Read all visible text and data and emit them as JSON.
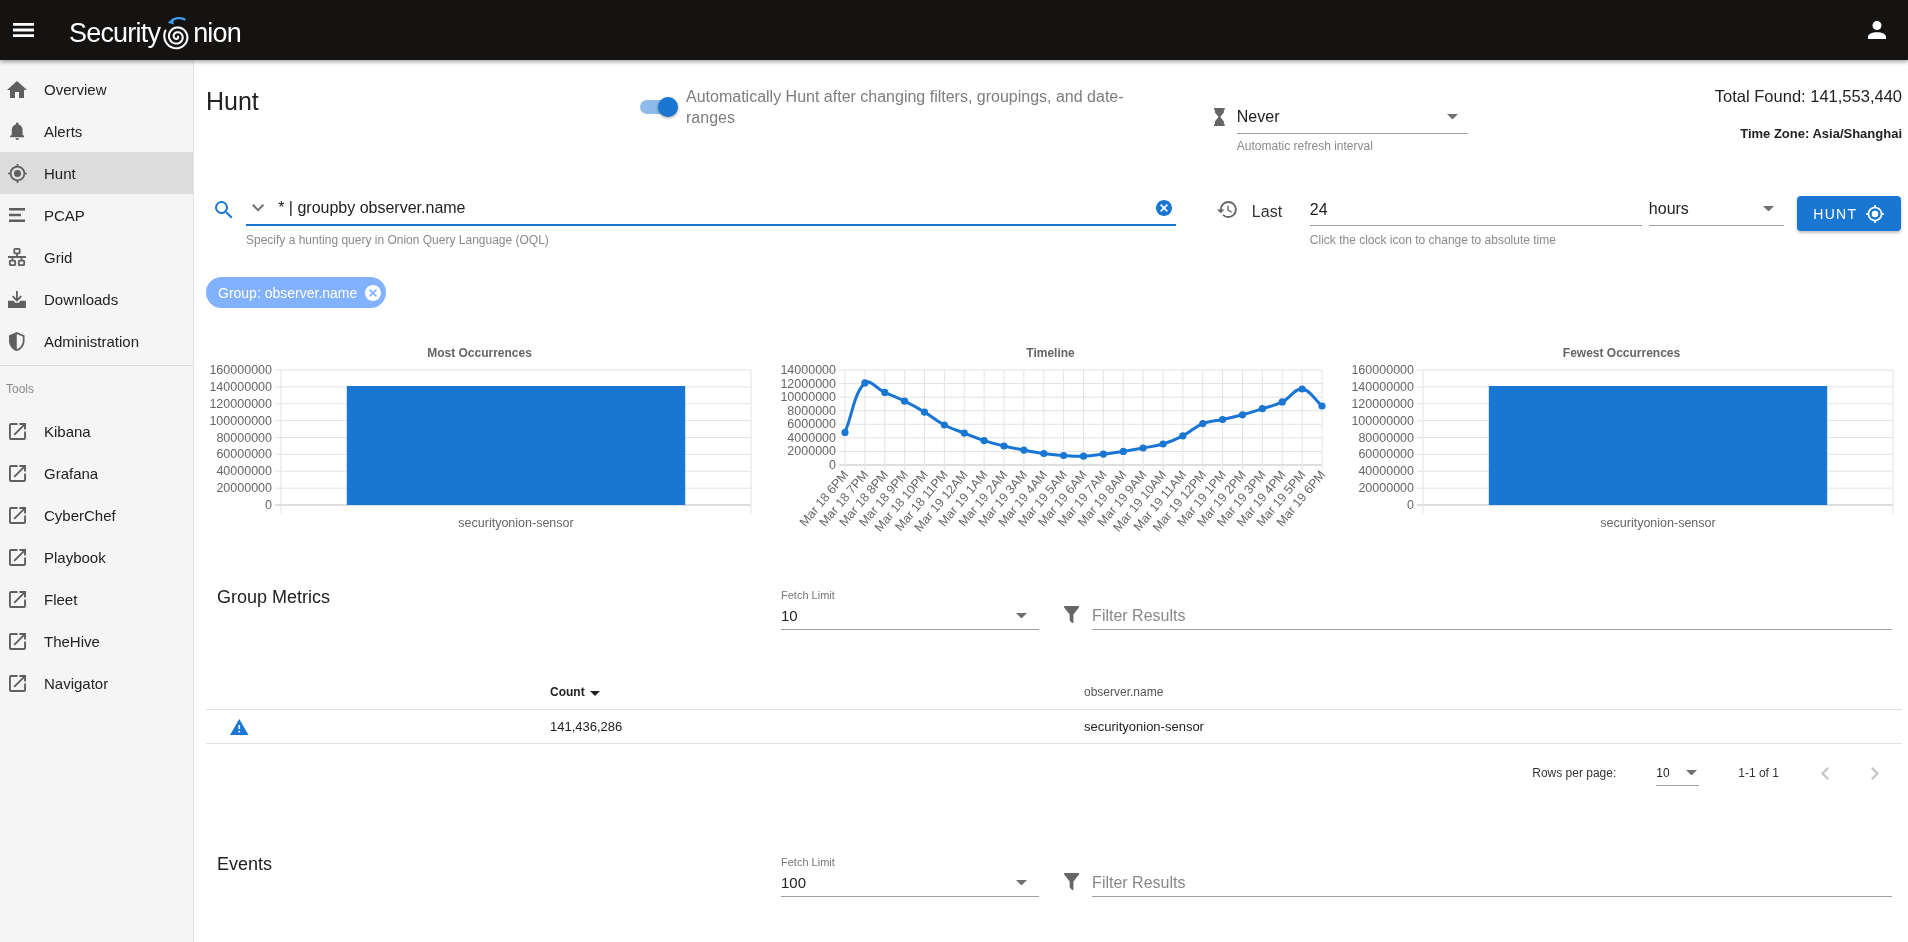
{
  "app_bar": {
    "logo_text_left": "Security",
    "logo_text_right": "nion"
  },
  "sidebar": {
    "items": [
      {
        "label": "Overview",
        "selected": false
      },
      {
        "label": "Alerts",
        "selected": false
      },
      {
        "label": "Hunt",
        "selected": true
      },
      {
        "label": "PCAP",
        "selected": false
      },
      {
        "label": "Grid",
        "selected": false
      },
      {
        "label": "Downloads",
        "selected": false
      },
      {
        "label": "Administration",
        "selected": false
      }
    ],
    "tools_title": "Tools",
    "tools": [
      {
        "label": "Kibana"
      },
      {
        "label": "Grafana"
      },
      {
        "label": "CyberChef"
      },
      {
        "label": "Playbook"
      },
      {
        "label": "Fleet"
      },
      {
        "label": "TheHive"
      },
      {
        "label": "Navigator"
      }
    ]
  },
  "header": {
    "title": "Hunt",
    "auto_hunt": {
      "on": true,
      "label": "Automatically Hunt after changing filters, groupings, and date-ranges"
    },
    "refresh": {
      "value": "Never",
      "hint": "Automatic refresh interval"
    },
    "total_found": "Total Found: 141,553,440",
    "time_zone": "Time Zone: Asia/Shanghai"
  },
  "query": {
    "value": "* | groupby observer.name",
    "hint": "Specify a hunting query in Onion Query Language (OQL)"
  },
  "time_range": {
    "label": "Last",
    "value": "24",
    "unit": "hours",
    "hint": "Click the clock icon to change to absolute time"
  },
  "hunt_button": {
    "label": "HUNT"
  },
  "chips": [
    {
      "label": "Group: observer.name"
    }
  ],
  "charts": [
    {
      "chart_data": {
        "type": "bar",
        "title": "Most Occurrences",
        "categories": [
          "securityonion-sensor"
        ],
        "values": [
          141000000
        ],
        "ylim": [
          0,
          160000000
        ],
        "yticks": [
          0,
          20000000,
          40000000,
          60000000,
          80000000,
          100000000,
          120000000,
          140000000,
          160000000
        ],
        "grid": true
      }
    },
    {
      "chart_data": {
        "type": "line",
        "title": "Timeline",
        "categories": [
          "Mar 18 6PM",
          "Mar 18 7PM",
          "Mar 18 8PM",
          "Mar 18 9PM",
          "Mar 18 10PM",
          "Mar 18 11PM",
          "Mar 19 12AM",
          "Mar 19 1AM",
          "Mar 19 2AM",
          "Mar 19 3AM",
          "Mar 19 4AM",
          "Mar 19 5AM",
          "Mar 19 6AM",
          "Mar 19 7AM",
          "Mar 19 8AM",
          "Mar 19 9AM",
          "Mar 19 10AM",
          "Mar 19 11AM",
          "Mar 19 12PM",
          "Mar 19 1PM",
          "Mar 19 2PM",
          "Mar 19 3PM",
          "Mar 19 4PM",
          "Mar 19 5PM",
          "Mar 19 6PM"
        ],
        "values": [
          4800000,
          12100000,
          10700000,
          9400000,
          7800000,
          5900000,
          4700000,
          3600000,
          2800000,
          2200000,
          1700000,
          1400000,
          1300000,
          1600000,
          2000000,
          2500000,
          3100000,
          4300000,
          6100000,
          6700000,
          7400000,
          8300000,
          9300000,
          11200000,
          8700000
        ],
        "ylim": [
          0,
          14000000
        ],
        "yticks": [
          0,
          2000000,
          4000000,
          6000000,
          8000000,
          10000000,
          12000000,
          14000000
        ],
        "grid": true,
        "marker": true
      }
    },
    {
      "chart_data": {
        "type": "bar",
        "title": "Fewest Occurrences",
        "categories": [
          "securityonion-sensor"
        ],
        "values": [
          141000000
        ],
        "ylim": [
          0,
          160000000
        ],
        "yticks": [
          0,
          20000000,
          40000000,
          60000000,
          80000000,
          100000000,
          120000000,
          140000000,
          160000000
        ],
        "grid": true
      }
    }
  ],
  "group_metrics": {
    "title": "Group Metrics",
    "fetch_limit": {
      "label": "Fetch Limit",
      "value": "10"
    },
    "filter": {
      "placeholder": "Filter Results"
    },
    "table": {
      "columns": [
        {
          "label": "Count",
          "sorted": true
        },
        {
          "label": "observer.name",
          "sorted": false
        }
      ],
      "rows": [
        {
          "cells": [
            "141,436,286",
            "securityonion-sensor"
          ]
        }
      ]
    },
    "pagination": {
      "rows_per_page_label": "Rows per page:",
      "rows_per_page": "10",
      "range": "1-1 of 1",
      "previous_disabled": true,
      "next_disabled": true
    }
  },
  "events": {
    "title": "Events",
    "fetch_limit": {
      "label": "Fetch Limit",
      "value": "100"
    },
    "filter": {
      "placeholder": "Filter Results"
    }
  }
}
